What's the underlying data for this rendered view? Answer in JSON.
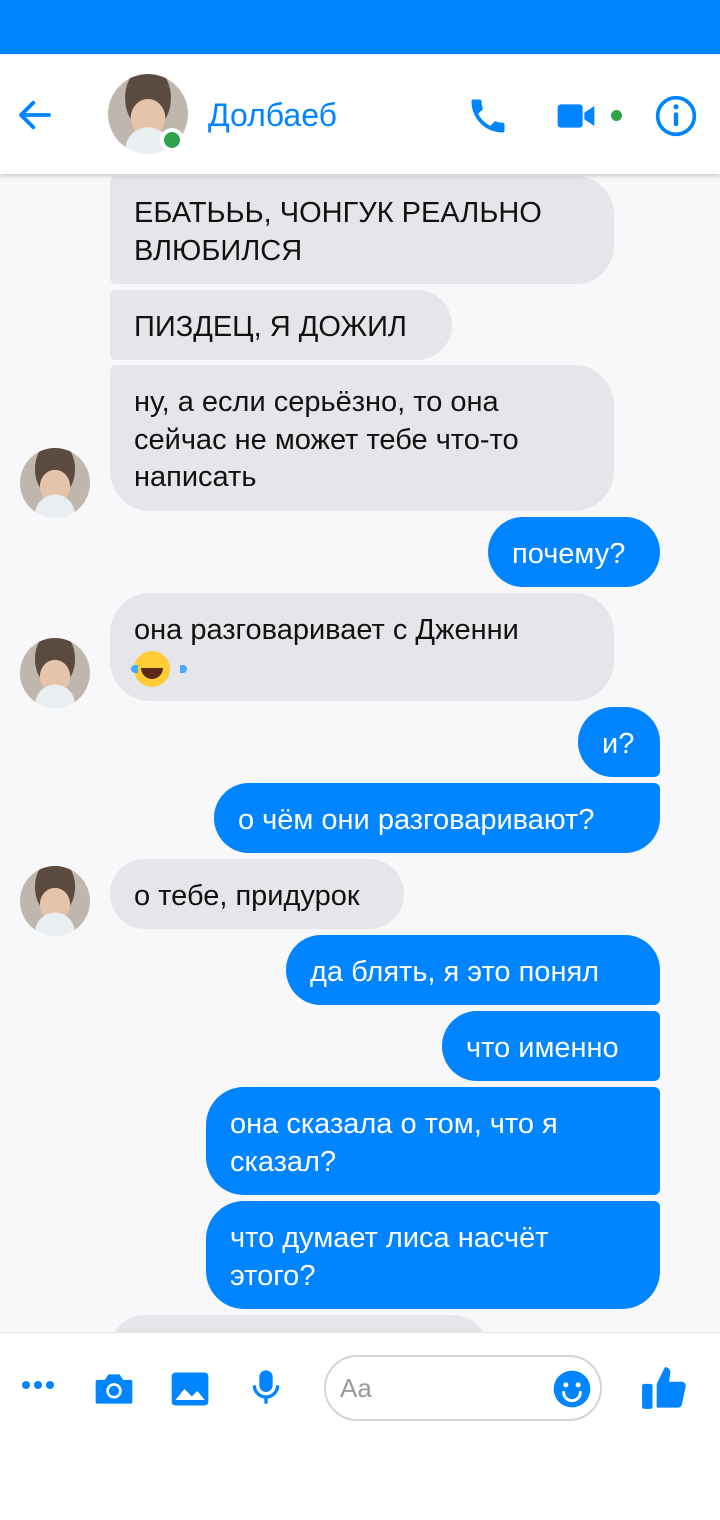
{
  "app": {
    "accent": "#0084ff",
    "incoming_bubble": "#e6e6ea",
    "online": "#31a24c"
  },
  "header": {
    "title": "Долбаеб",
    "icons": [
      "back-arrow-icon",
      "avatar",
      "phone-icon",
      "video-camera-icon",
      "info-icon"
    ]
  },
  "messages": [
    {
      "dir": "in",
      "text": "ЕБАТЬЬЬ, ЧОНГУК РЕАЛЬНО\nВЛЮБИЛСЯ"
    },
    {
      "dir": "in",
      "text": "ПИЗДЕЦ, Я ДОЖИЛ"
    },
    {
      "dir": "in",
      "text": "ну, а если серьёзно, то она\nсейчас не может тебе что-то\nнаписать",
      "avatar": true
    },
    {
      "dir": "out",
      "text": "почему?"
    },
    {
      "dir": "in",
      "text": "она разговаривает с Дженни",
      "emoji": "face-with-tears-of-joy",
      "avatar": true
    },
    {
      "dir": "out",
      "text": "и?"
    },
    {
      "dir": "out",
      "text": "о чём они разговаривают?"
    },
    {
      "dir": "in",
      "text": "о тебе, придурок",
      "avatar": true
    },
    {
      "dir": "out",
      "text": "да блять, я это понял"
    },
    {
      "dir": "out",
      "text": "что именно"
    },
    {
      "dir": "out",
      "text": "она сказала о том, что я\nсказал?"
    },
    {
      "dir": "out",
      "text": "что думает лиса насчёт\nэтого?"
    },
    {
      "dir": "in",
      "text": ""
    }
  ],
  "composer": {
    "placeholder": "Aa",
    "icons": [
      "more-icon",
      "camera-icon",
      "gallery-icon",
      "microphone-icon",
      "emoji-icon",
      "thumbs-up-icon"
    ]
  }
}
